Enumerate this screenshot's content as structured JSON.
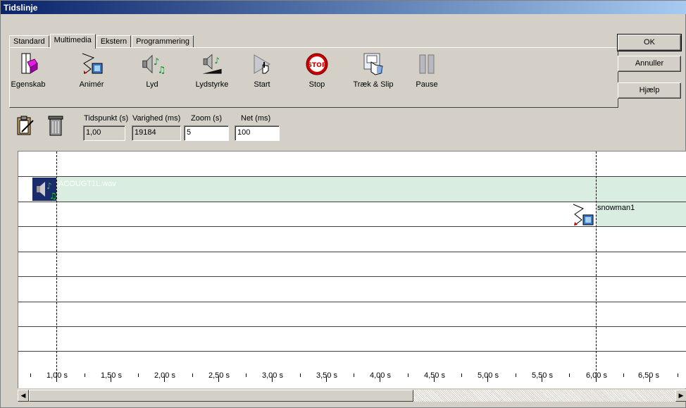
{
  "window": {
    "title": "Tidslinje"
  },
  "tabs": [
    {
      "label": "Standard",
      "active": false
    },
    {
      "label": "Multimedia",
      "active": true
    },
    {
      "label": "Ekstern",
      "active": false
    },
    {
      "label": "Programmering",
      "active": false
    }
  ],
  "toolbar": [
    {
      "label": "Egenskab",
      "icon": "property-icon"
    },
    {
      "label": "Animér",
      "icon": "animate-icon"
    },
    {
      "label": "Lyd",
      "icon": "sound-icon"
    },
    {
      "label": "Lydstyrke",
      "icon": "volume-icon"
    },
    {
      "label": "Start",
      "icon": "start-icon"
    },
    {
      "label": "Stop",
      "icon": "stop-sign-icon",
      "icon_text": "STOP"
    },
    {
      "label": "Træk & Slip",
      "icon": "drag-drop-icon"
    },
    {
      "label": "Pause",
      "icon": "pause-icon"
    }
  ],
  "buttons": {
    "ok": "OK",
    "cancel": "Annuller",
    "help": "Hjælp"
  },
  "params": {
    "tidspunkt": {
      "label": "Tidspunkt (s)",
      "value": "1,00"
    },
    "varighed": {
      "label": "Varighed (ms)",
      "value": "19184"
    },
    "zoom": {
      "label": "Zoom (s)",
      "value": "5"
    },
    "net": {
      "label": "Net (ms)",
      "value": "100"
    }
  },
  "timeline": {
    "tracks": [
      {
        "label": "ACOUGT1L.wav",
        "type": "sound"
      },
      {
        "label": "snowman1",
        "type": "animation"
      }
    ],
    "ticks": [
      "1,00 s",
      "1,50 s",
      "2,00 s",
      "2,50 s",
      "3,00 s",
      "3,50 s",
      "4,00 s",
      "4,50 s",
      "5,00 s",
      "5,50 s",
      "6,00 s",
      "6,50 s"
    ]
  },
  "colors": {
    "track_band": "#d9ede0",
    "title_start": "#0a246a",
    "title_end": "#a6caf0",
    "stop_red": "#cc0000"
  }
}
